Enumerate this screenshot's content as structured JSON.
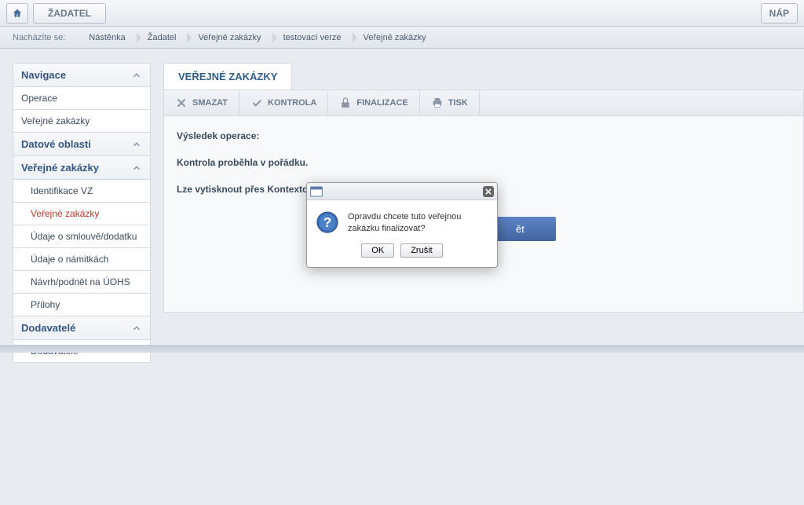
{
  "top": {
    "zadatel": "ŽADATEL",
    "nap": "NÁP"
  },
  "breadcrumb": {
    "label": "Nacházíte se:",
    "items": [
      "Nástěnka",
      "Žadatel",
      "Veřejné zakázky",
      "testovací verze",
      "Veřejné zakázky"
    ]
  },
  "sidebar": {
    "nav_header": "Navigace",
    "operace": "Operace",
    "verejne": "Veřejné zakázky",
    "datove_header": "Datové oblasti",
    "vz_header": "Veřejné zakázky",
    "sub": {
      "identifikace": "Identifikace VZ",
      "vz": "Veřejné zakázky",
      "smlouva": "Údaje o smlouvě/dodatku",
      "namitky": "Údaje o námitkách",
      "uohs": "Návrh/podnět na ÚOHS",
      "prilohy": "Přílohy"
    },
    "dodavatele_header": "Dodavatelé",
    "dodavatele_item": "Dodavatelé"
  },
  "content": {
    "tab": "VEŘEJNÉ ZAKÁZKY",
    "smazat": "SMAZAT",
    "kontrola": "KONTROLA",
    "finalizace": "FINALIZACE",
    "tisk": "TISK",
    "result_label": "Výsledek operace:",
    "result_msg": "Kontrola proběhla v pořádku.",
    "result_extra": "Lze vytisknout přes Kontextovou nabídku",
    "back": "ět"
  },
  "modal": {
    "text": "Opravdu chcete tuto veřejnou zakázku finalizovat?",
    "ok": "OK",
    "cancel": "Zrušit"
  }
}
